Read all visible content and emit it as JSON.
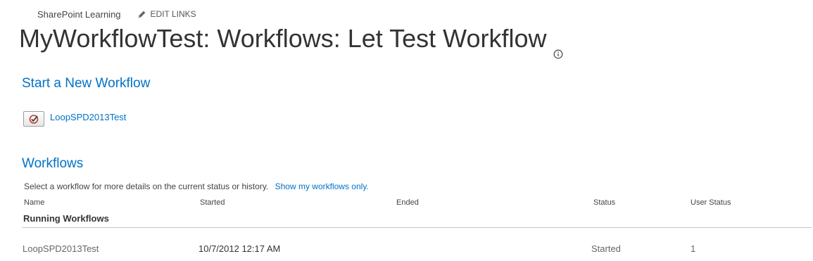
{
  "nav": {
    "site_title": "SharePoint Learning",
    "edit_links": "EDIT LINKS"
  },
  "page": {
    "title": "MyWorkflowTest: Workflows: Let Test Workflow"
  },
  "start_section": {
    "heading": "Start a New Workflow",
    "workflows": [
      {
        "name": "LoopSPD2013Test",
        "icon": "workflow-check-icon"
      }
    ]
  },
  "workflows_section": {
    "heading": "Workflows",
    "description": "Select a workflow for more details on the current status or history.",
    "my_workflows_link": "Show my workflows only.",
    "columns": {
      "name": "Name",
      "started": "Started",
      "ended": "Ended",
      "status": "Status",
      "user_status": "User Status"
    },
    "group_label": "Running Workflows",
    "rows": [
      {
        "name": "LoopSPD2013Test",
        "started": "10/7/2012 12:17 AM",
        "ended": "",
        "status": "Started",
        "user_status": "1"
      }
    ]
  },
  "colors": {
    "accent": "#0072c6",
    "text": "#444444",
    "divider": "#c6c6c6"
  }
}
